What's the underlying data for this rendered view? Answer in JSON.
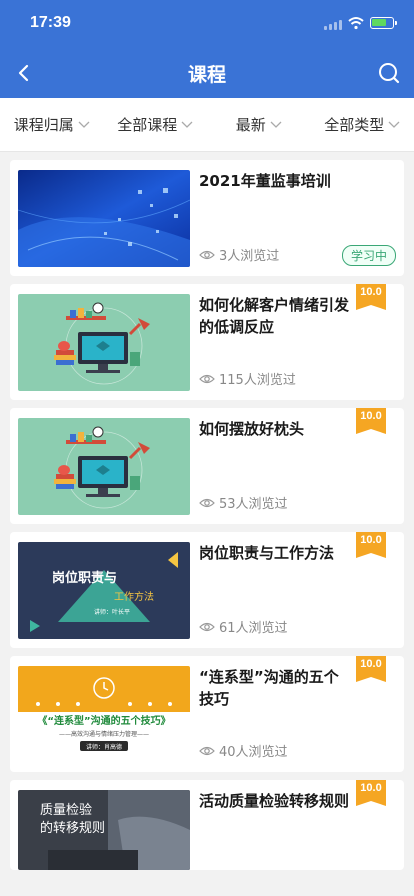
{
  "status_bar": {
    "time": "17:39"
  },
  "header": {
    "title": "课程"
  },
  "filters": [
    {
      "label": "课程归属"
    },
    {
      "label": "全部课程"
    },
    {
      "label": "最新"
    },
    {
      "label": "全部类型"
    }
  ],
  "courses": [
    {
      "title": "2021年董监事培训",
      "views": "3人浏览过",
      "status": "学习中",
      "score": ""
    },
    {
      "title": "如何化解客户情绪引发的低调反应",
      "views": "115人浏览过",
      "status": "",
      "score": "10.0"
    },
    {
      "title": "如何摆放好枕头",
      "views": "53人浏览过",
      "status": "",
      "score": "10.0"
    },
    {
      "title": "岗位职责与工作方法",
      "views": "61人浏览过",
      "status": "",
      "score": "10.0",
      "thumb_text": [
        "岗位职责与",
        "工作方法",
        "讲师：叶长平"
      ]
    },
    {
      "title": "“连系型”沟通的五个技巧",
      "views": "40人浏览过",
      "status": "",
      "score": "10.0",
      "thumb_text": [
        "《“连系型”沟通的五个技巧》",
        "——高效沟通与情绪压力管理——",
        "讲师：肖高德"
      ]
    },
    {
      "title": "活动质量检验转移规则",
      "views": "",
      "status": "",
      "score": "10.0",
      "thumb_text": [
        "质量检验",
        "的转移规则"
      ]
    }
  ],
  "colors": {
    "primary": "#3a73d6",
    "badge": "#f5a623",
    "status_green": "#3aa776"
  },
  "icons": {
    "back": "chevron-left-icon",
    "search": "search-icon",
    "view": "eye-icon"
  }
}
